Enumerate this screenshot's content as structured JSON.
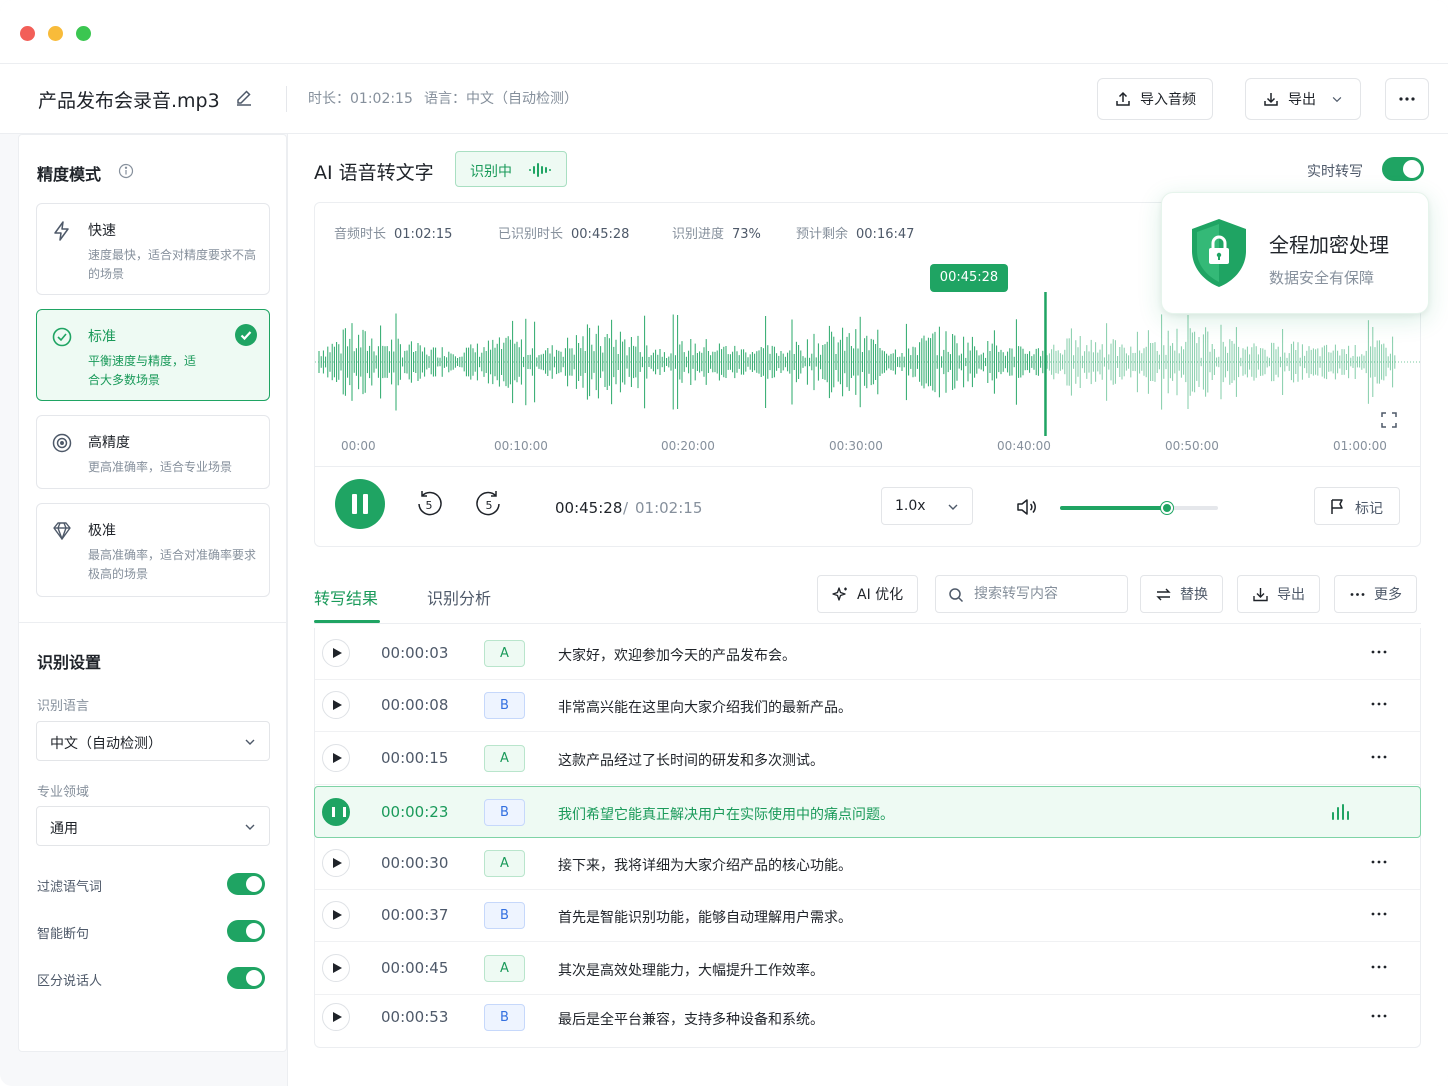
{
  "window": {
    "file_name": "产品发布会录音.mp3",
    "duration_label": "时长：01:02:15",
    "language_label": "语言：中文（自动检测）",
    "import_label": "导入音频",
    "export_label": "导出",
    "accent": "#1fa463"
  },
  "sidebar": {
    "precision_title": "精度模式",
    "modes": [
      {
        "name": "快速",
        "desc": "速度最快，适合对精度要求不高的场景",
        "icon": "lightning-icon",
        "selected": false
      },
      {
        "name": "标准",
        "desc": "平衡速度与精度，适合大多数场景",
        "icon": "check-circle-icon",
        "selected": true
      },
      {
        "name": "高精度",
        "desc": "更高准确率，适合专业场景",
        "icon": "target-icon",
        "selected": false
      },
      {
        "name": "极准",
        "desc": "最高准确率，适合对准确率要求极高的场景",
        "icon": "diamond-icon",
        "selected": false
      }
    ],
    "settings_title": "识别设置",
    "lang_label": "识别语言",
    "lang_value": "中文（自动检测）",
    "domain_label": "专业领域",
    "domain_value": "通用",
    "toggles": [
      {
        "label": "过滤语气词",
        "on": true
      },
      {
        "label": "智能断句",
        "on": true
      },
      {
        "label": "区分说话人",
        "on": true
      }
    ]
  },
  "main": {
    "title": "AI 语音转文字",
    "status": "识别中",
    "realtime_label": "实时转写",
    "realtime_on": true
  },
  "player": {
    "stats": [
      {
        "label": "音频时长",
        "value": "01:02:15"
      },
      {
        "label": "已识别时长",
        "value": "00:45:28"
      },
      {
        "label": "识别进度",
        "value": "73%"
      },
      {
        "label": "预计剩余",
        "value": "00:16:47"
      }
    ],
    "playhead": "00:45:28",
    "playhead_fraction": 0.73,
    "ticks": [
      "00:00",
      "00:10:00",
      "00:20:00",
      "00:30:00",
      "00:40:00",
      "00:50:00",
      "01:00:00"
    ],
    "current_time": "00:45:28",
    "time_sep": "/",
    "total_time": "01:02:15",
    "speed": "1.0x",
    "volume": 0.68,
    "skip_seconds": "5",
    "mark_label": "标记"
  },
  "secure": {
    "title": "全程加密处理",
    "subtitle": "数据安全有保障"
  },
  "results": {
    "tabs": [
      "转写结果",
      "识别分析"
    ],
    "ai_label": "AI 优化",
    "search_placeholder": "搜索转写内容",
    "replace_label": "替换",
    "export_label": "导出",
    "more_label": "更多",
    "rows": [
      {
        "time": "00:00:03",
        "speaker": "A",
        "text": "大家好，欢迎参加今天的产品发布会。"
      },
      {
        "time": "00:00:08",
        "speaker": "B",
        "text": "非常高兴能在这里向大家介绍我们的最新产品。"
      },
      {
        "time": "00:00:15",
        "speaker": "A",
        "text": "这款产品经过了长时间的研发和多次测试。"
      },
      {
        "time": "00:00:23",
        "speaker": "B",
        "text": "我们希望它能真正解决用户在实际使用中的痛点问题。",
        "active": true
      },
      {
        "time": "00:00:30",
        "speaker": "A",
        "text": "接下来，我将详细为大家介绍产品的核心功能。"
      },
      {
        "time": "00:00:37",
        "speaker": "B",
        "text": "首先是智能识别功能，能够自动理解用户需求。"
      },
      {
        "time": "00:00:45",
        "speaker": "A",
        "text": "其次是高效处理能力，大幅提升工作效率。"
      },
      {
        "time": "00:00:53",
        "speaker": "B",
        "text": "最后是全平台兼容，支持多种设备和系统。"
      }
    ]
  }
}
